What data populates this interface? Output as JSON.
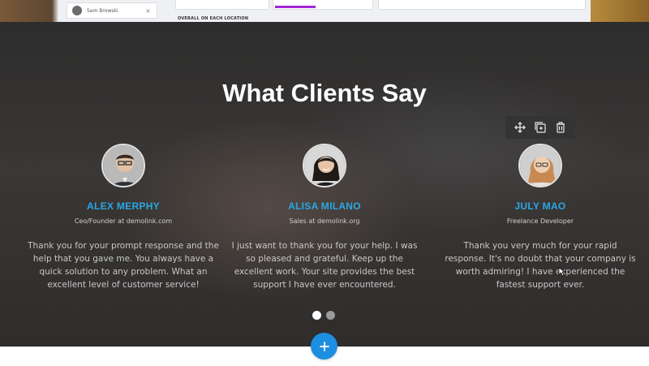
{
  "preview": {
    "user_name": "Sam Browski",
    "close_glyph": "×",
    "overall_label": "OVERALL ON EACH LOCATION"
  },
  "testimonials": {
    "title": "What Clients Say",
    "items": [
      {
        "name": "ALEX MERPHY",
        "role": "Ceo/Founder at demolink.com",
        "quote": "Thank you for your prompt response and the help that you gave me. You always have a quick solution to any problem. What an excellent level of customer service!"
      },
      {
        "name": "ALISA MILANO",
        "role": "Sales at demolink.org",
        "quote": "I just want to thank you for your help. I was so pleased and grateful. Keep up the excellent work. Your site provides the best support I have ever encountered."
      },
      {
        "name": "JULY MAO",
        "role": "Freelance Developer",
        "quote": "Thank you very much for your rapid response. It's no doubt that your company is worth admiring! I have experienced the fastest support ever."
      }
    ],
    "slides": {
      "count": 2,
      "active_index": 0
    }
  },
  "toolbar": {
    "icons": [
      "move-icon",
      "duplicate-icon",
      "trash-icon"
    ]
  },
  "colors": {
    "accent_name": "#29a8e6",
    "add_button": "#1e8fe0",
    "toolbar_bg": "#343434"
  },
  "add_button": {
    "glyph": "+"
  }
}
